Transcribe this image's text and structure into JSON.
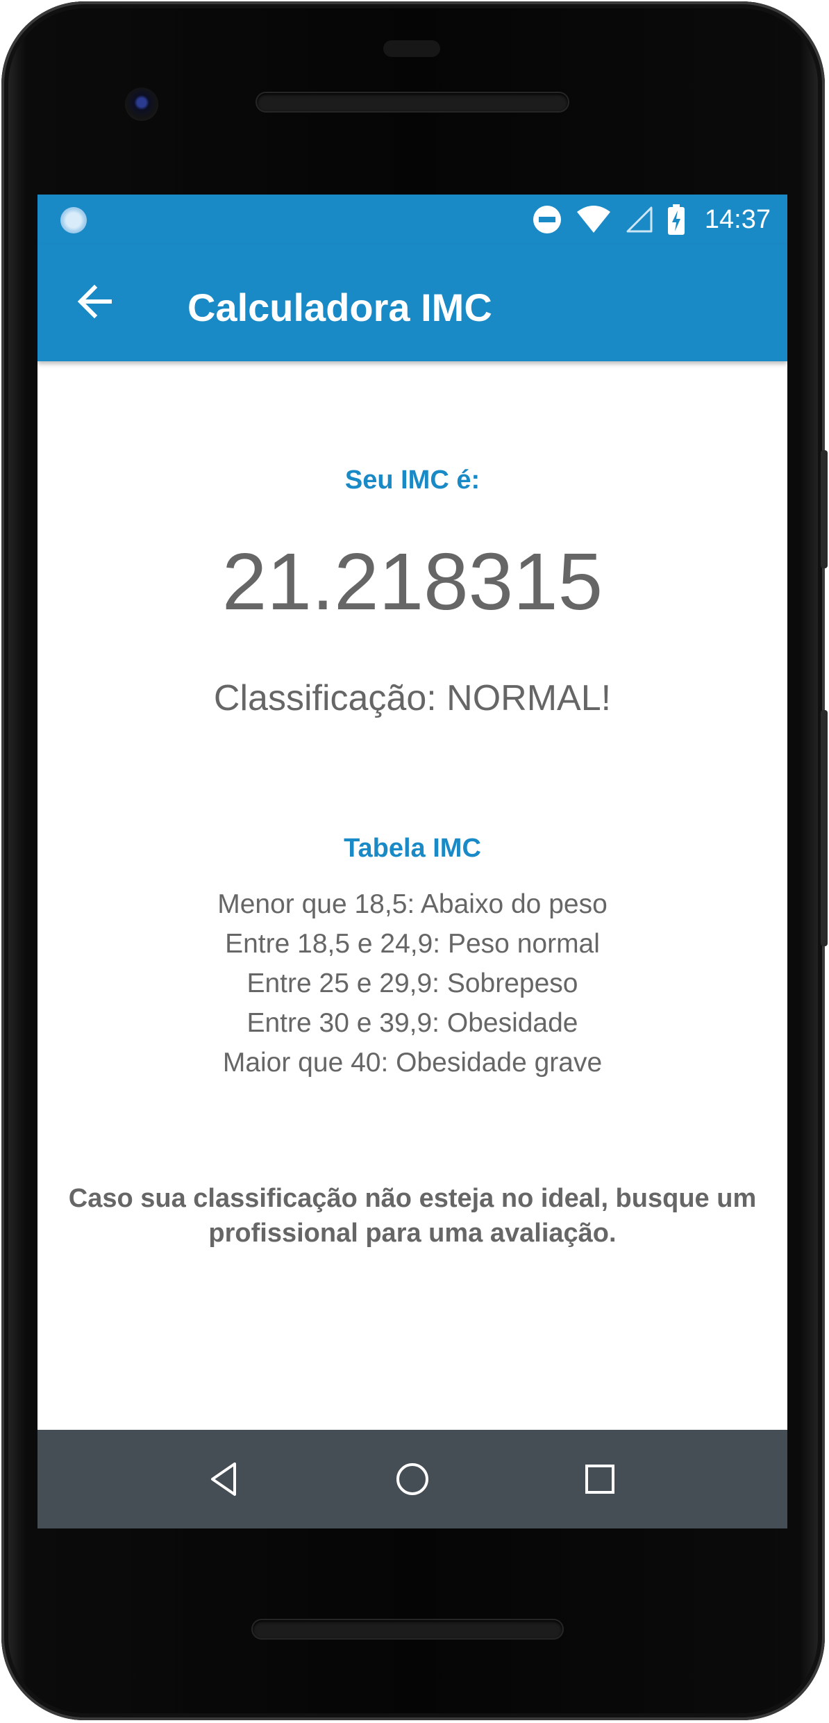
{
  "status_bar": {
    "time": "14:37",
    "icons": [
      "notification-dot-icon",
      "do-not-disturb-icon",
      "wifi-icon",
      "cellular-signal-icon",
      "battery-charging-icon"
    ]
  },
  "app_bar": {
    "title": "Calculadora IMC",
    "back_icon": "arrow-back-icon"
  },
  "result": {
    "label": "Seu IMC é:",
    "value": "21.218315",
    "classification": "Classificação: NORMAL!"
  },
  "table": {
    "title": "Tabela IMC",
    "rows": [
      "Menor que 18,5: Abaixo do peso",
      "Entre 18,5 e 24,9: Peso normal",
      "Entre 25 e 29,9: Sobrepeso",
      "Entre 30 e 39,9: Obesidade",
      "Maior que 40: Obesidade grave"
    ]
  },
  "advice": "Caso sua classificação não esteja no ideal, busque um profissional para uma avaliação.",
  "nav_bar": {
    "buttons": [
      "back-triangle-icon",
      "home-circle-icon",
      "recents-square-icon"
    ]
  },
  "colors": {
    "primary": "#1a8ac7",
    "text_gray": "#666666",
    "nav_bar": "#454e54"
  }
}
